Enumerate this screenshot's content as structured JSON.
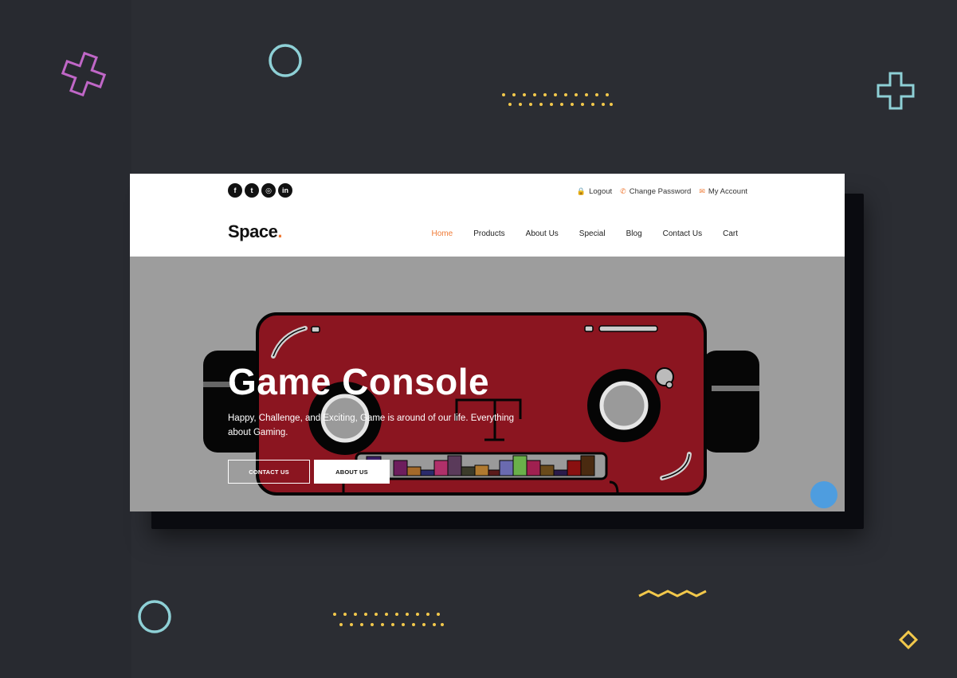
{
  "social": {
    "icons": [
      {
        "name": "facebook-icon",
        "glyph": "f"
      },
      {
        "name": "twitter-icon",
        "glyph": "t"
      },
      {
        "name": "instagram-icon",
        "glyph": "◎"
      },
      {
        "name": "linkedin-icon",
        "glyph": "in"
      }
    ]
  },
  "account": {
    "logout": "Logout",
    "change_password": "Change Password",
    "my_account": "My Account"
  },
  "brand": {
    "name": "Space",
    "dot": ".",
    "accent": "#f07a35"
  },
  "nav": {
    "items": [
      "Home",
      "Products",
      "About Us",
      "Special",
      "Blog",
      "Contact Us",
      "Cart"
    ],
    "active": "Home"
  },
  "hero": {
    "title": "Game Console",
    "subtitle": "Happy, Challenge, and Exciting, Game is around of our life. Everything about Gaming.",
    "contact_btn": "CONTACT US",
    "about_btn": "ABOUT US",
    "console_color": "#8b1520"
  }
}
